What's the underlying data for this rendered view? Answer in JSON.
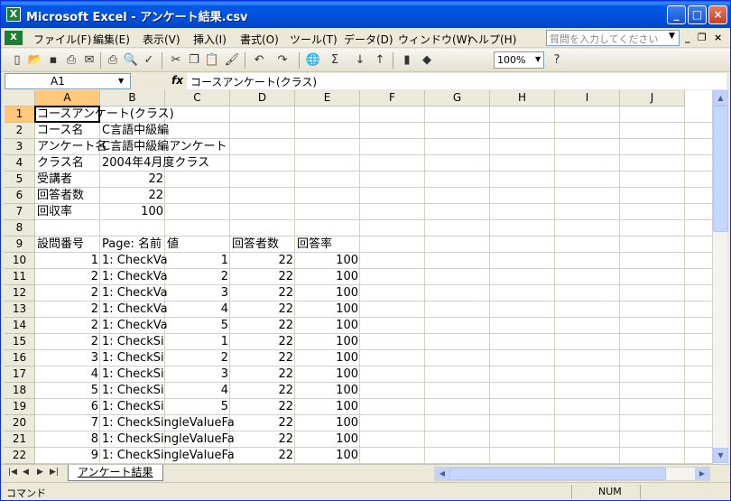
{
  "window": {
    "title": "Microsoft Excel - アンケート結果.csv",
    "app_icon": "X",
    "minimize": "_",
    "maximize": "□",
    "close": "×"
  },
  "menu": {
    "items": [
      "ファイル(F)",
      "編集(E)",
      "表示(V)",
      "挿入(I)",
      "書式(O)",
      "ツール(T)",
      "データ(D)",
      "ウィンドウ(W)",
      "ヘルプ(H)"
    ],
    "help_placeholder": "質問を入力してください",
    "mdi_min": "_",
    "mdi_restore": "❐",
    "mdi_close": "×"
  },
  "toolbar": {
    "zoom": "100%",
    "sum_icon": "Σ",
    "fx_label": "fx"
  },
  "formula_bar": {
    "name_box": "A1",
    "fx": "fx",
    "content": "コースアンケート(クラス)"
  },
  "columns": [
    "A",
    "B",
    "C",
    "D",
    "E",
    "F",
    "G",
    "H",
    "I",
    "J"
  ],
  "rows": [
    "1",
    "2",
    "3",
    "4",
    "5",
    "6",
    "7",
    "8",
    "9",
    "10",
    "11",
    "12",
    "13",
    "14",
    "15",
    "16",
    "17",
    "18",
    "19",
    "20",
    "21",
    "22"
  ],
  "cells": {
    "r1": {
      "a": "コースアンケート(クラス)"
    },
    "r2": {
      "a": "コース名",
      "b": "C言語中級編"
    },
    "r3": {
      "a": "アンケート名",
      "b": "C言語中級編アンケート"
    },
    "r4": {
      "a": "クラス名",
      "b": "2004年4月度クラス"
    },
    "r5": {
      "a": "受講者",
      "b": "22"
    },
    "r6": {
      "a": "回答者数",
      "b": "22"
    },
    "r7": {
      "a": "回収率",
      "b": "100"
    },
    "r9": {
      "a": "設問番号",
      "b": "Page: 名前",
      "c": "値",
      "d": "回答者数",
      "e": "回答率"
    },
    "r10": {
      "a": "1",
      "b": "1: CheckVa",
      "c": "1",
      "d": "22",
      "e": "100"
    },
    "r11": {
      "a": "2",
      "b": "1: CheckVa",
      "c": "2",
      "d": "22",
      "e": "100"
    },
    "r12": {
      "a": "2",
      "b": "1: CheckVa",
      "c": "3",
      "d": "22",
      "e": "100"
    },
    "r13": {
      "a": "2",
      "b": "1: CheckVa",
      "c": "4",
      "d": "22",
      "e": "100"
    },
    "r14": {
      "a": "2",
      "b": "1: CheckVa",
      "c": "5",
      "d": "22",
      "e": "100"
    },
    "r15": {
      "a": "2",
      "b": "1: CheckSi",
      "c": "1",
      "d": "22",
      "e": "100"
    },
    "r16": {
      "a": "3",
      "b": "1: CheckSi",
      "c": "2",
      "d": "22",
      "e": "100"
    },
    "r17": {
      "a": "4",
      "b": "1: CheckSi",
      "c": "3",
      "d": "22",
      "e": "100"
    },
    "r18": {
      "a": "5",
      "b": "1: CheckSi",
      "c": "4",
      "d": "22",
      "e": "100"
    },
    "r19": {
      "a": "6",
      "b": "1: CheckSi",
      "c": "5",
      "d": "22",
      "e": "100"
    },
    "r20": {
      "a": "7",
      "b": "1: CheckSingleValueFa",
      "d": "22",
      "e": "100"
    },
    "r21": {
      "a": "8",
      "b": "1: CheckSingleValueFa",
      "d": "22",
      "e": "100"
    },
    "r22": {
      "a": "9",
      "b": "1: CheckSingleValueFa",
      "d": "22",
      "e": "100"
    }
  },
  "sheet_tab": "アンケート結果",
  "status": {
    "mode": "コマンド",
    "num": "NUM"
  }
}
